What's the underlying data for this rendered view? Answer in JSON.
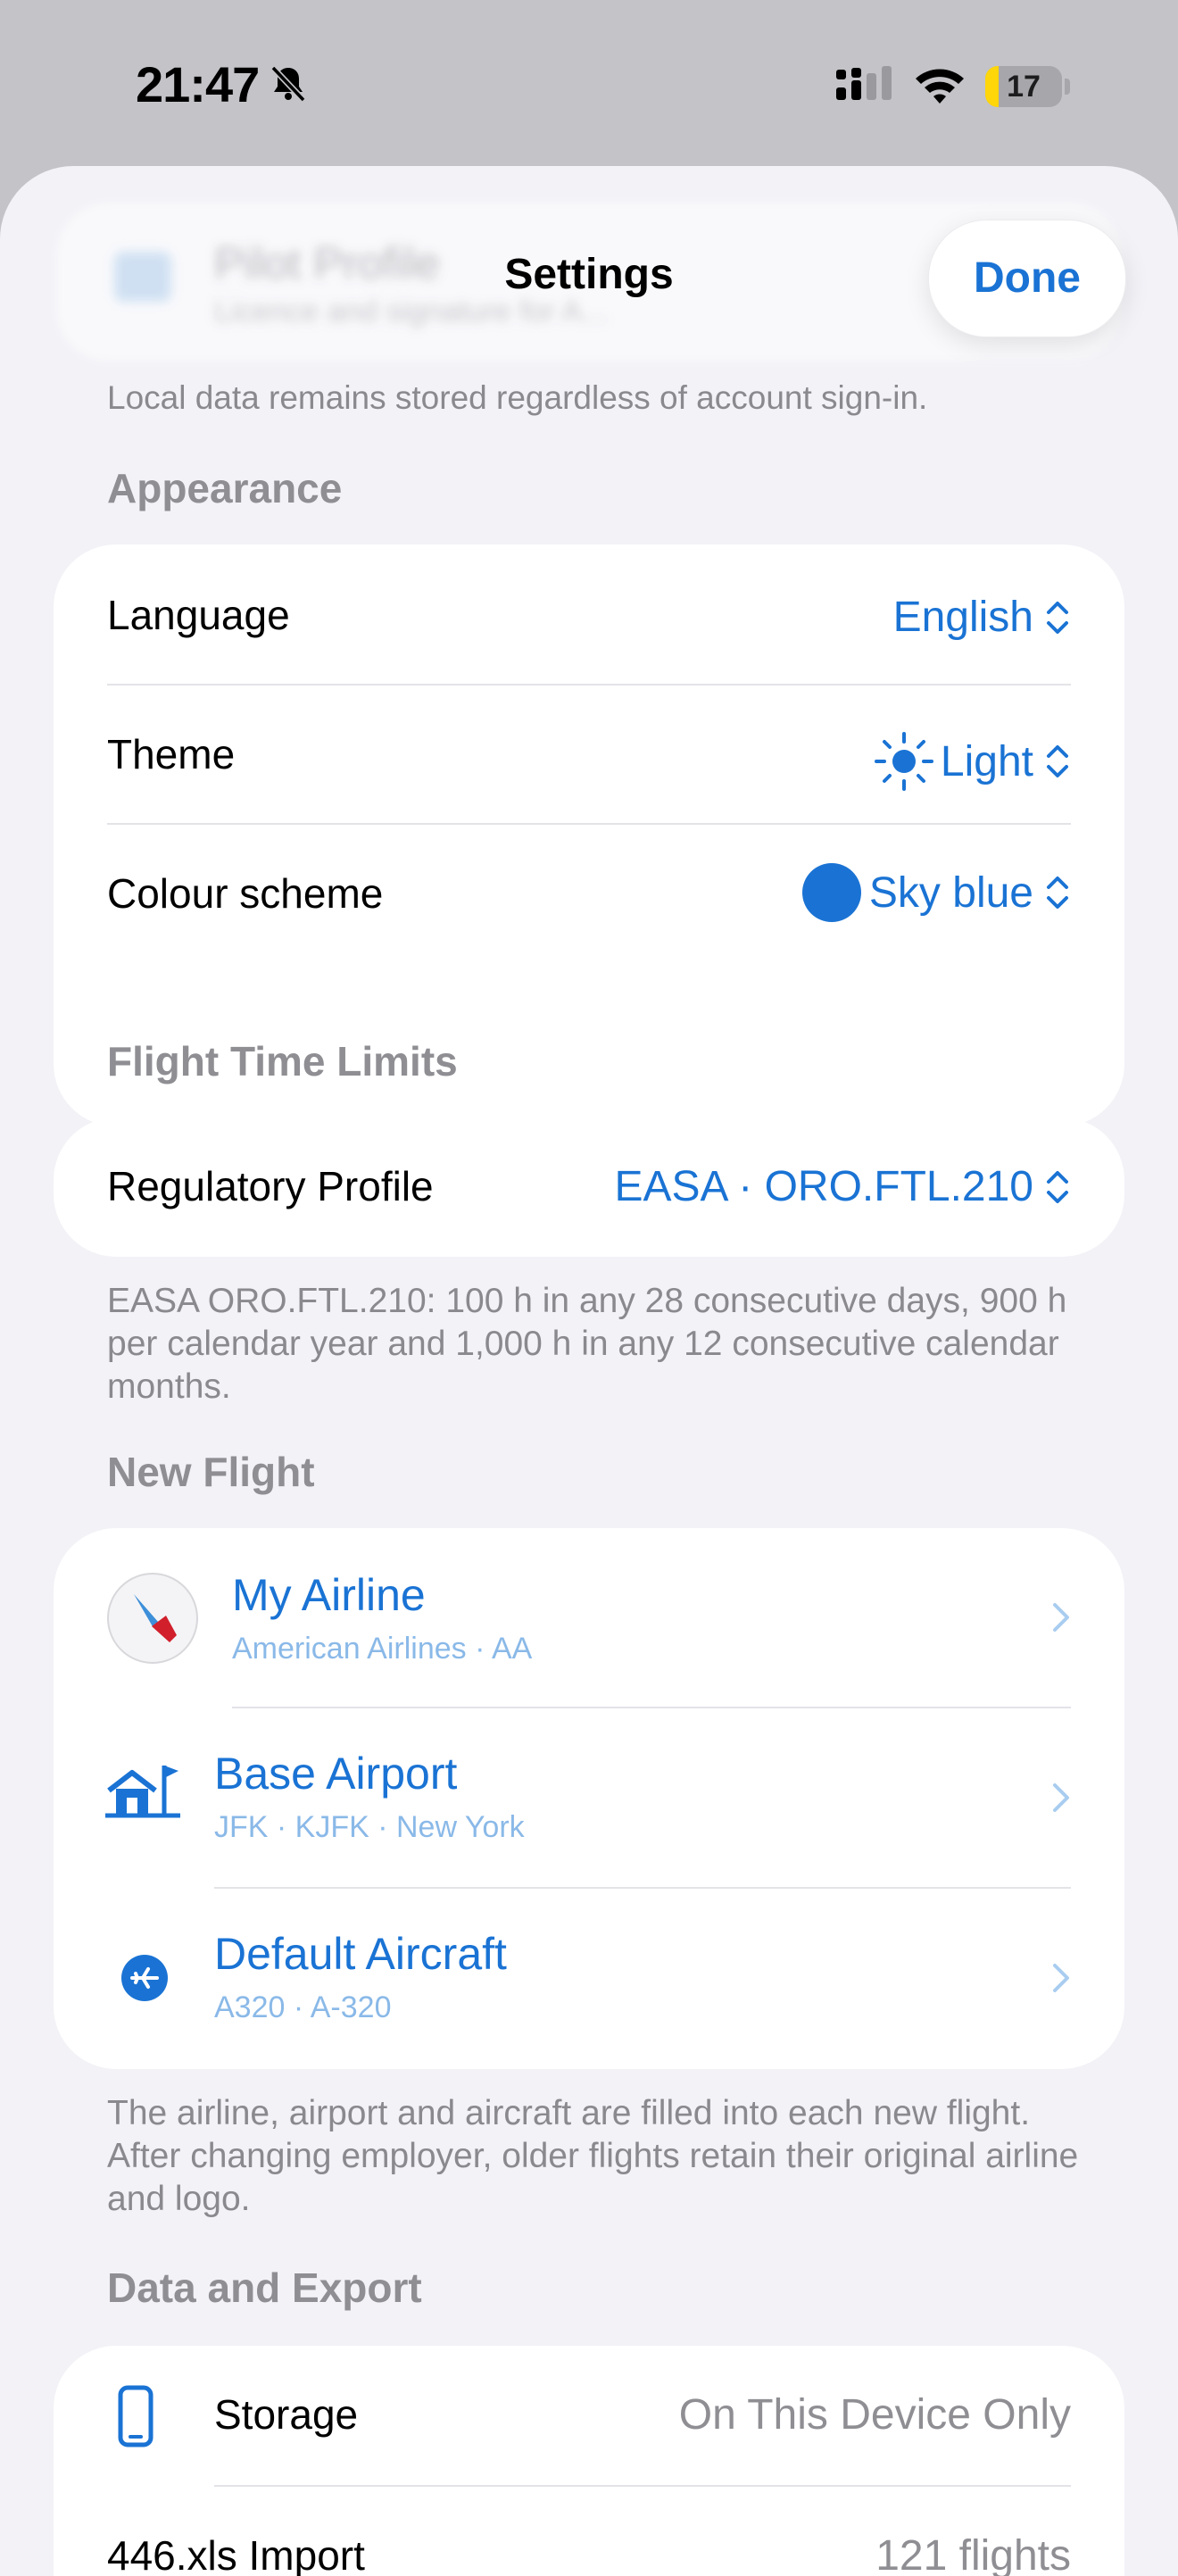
{
  "status_bar": {
    "time": "21:47",
    "battery": "17",
    "battery_level": 0.17
  },
  "header": {
    "behind_title": "Pilot Profile",
    "behind_subtitle": "Licence and signature for A...",
    "title": "Settings",
    "done_label": "Done"
  },
  "account_footnote": "Local data remains stored regardless of account sign-in.",
  "appearance": {
    "heading": "Appearance",
    "rows": [
      {
        "label": "Language",
        "value": "English"
      },
      {
        "label": "Theme",
        "value": "Light",
        "icon": "sun-icon"
      },
      {
        "label": "Colour scheme",
        "value": "Sky blue",
        "swatch": "#1a73d4"
      }
    ]
  },
  "ftl": {
    "heading": "Flight Time Limits",
    "label": "Regulatory Profile",
    "value": "EASA · ORO.FTL.210",
    "footnote": "EASA ORO.FTL.210: 100 h in any 28 consecutive days, 900 h per calendar year and 1,000 h in any 12 consecutive calendar months."
  },
  "new_flight": {
    "heading": "New Flight",
    "rows": [
      {
        "title": "My Airline",
        "subtitle": "American Airlines · AA",
        "icon": "airline-logo-icon"
      },
      {
        "title": "Base Airport",
        "subtitle": "JFK · KJFK · New York",
        "icon": "airport-icon"
      },
      {
        "title": "Default Aircraft",
        "subtitle": "A320 · A-320",
        "icon": "airplane-icon"
      }
    ],
    "footnote": "The airline, airport and aircraft are filled into each new flight. After changing employer, older flights retain their original airline and logo."
  },
  "data_export": {
    "heading": "Data and Export",
    "rows": [
      {
        "label": "Storage",
        "value": "On This Device Only",
        "icon": "phone-icon"
      },
      {
        "label": "446.xls Import",
        "value": "121 flights"
      }
    ]
  },
  "colors": {
    "accent": "#1a73d4",
    "background": "#f2f2f7",
    "secondary_text": "#8e8e93"
  }
}
